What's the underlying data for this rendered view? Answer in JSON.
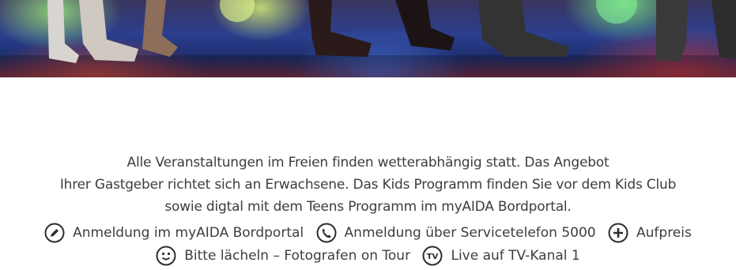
{
  "intro": {
    "line1": "Alle Veranstaltungen im Freien finden wetterabhängig statt. Das Angebot",
    "line2": "Ihrer Gastgeber richtet sich an Erwachsene. Das Kids Programm finden Sie vor dem Kids Club",
    "line3": "sowie digtal mit dem Teens Programm im myAIDA Bordportal."
  },
  "legend": [
    {
      "icon": "pencil-icon",
      "label": "Anmeldung im myAIDA Bordportal"
    },
    {
      "icon": "phone-icon",
      "label": "Anmeldung über Servicetelefon 5000"
    },
    {
      "icon": "plus-icon",
      "label": "Aufpreis"
    },
    {
      "icon": "smile-icon",
      "label": "Bitte lächeln – Fotografen on Tour"
    },
    {
      "icon": "tv-icon",
      "label": "Live auf TV-Kanal 1"
    }
  ],
  "colors": {
    "text": "#3d3d3d",
    "icon": "#2e2e2e"
  }
}
